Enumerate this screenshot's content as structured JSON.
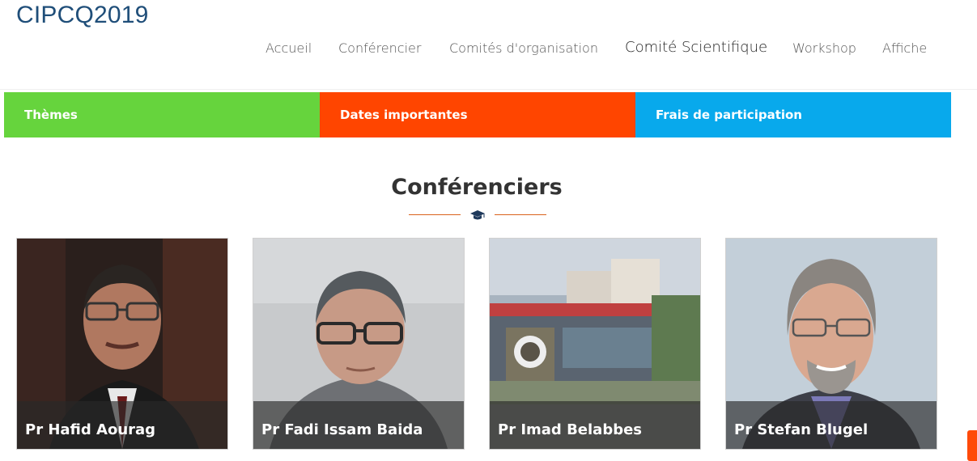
{
  "brand": {
    "title": "CIPCQ2019"
  },
  "nav": {
    "items": [
      {
        "label": "Accueil"
      },
      {
        "label": "Conférencier"
      },
      {
        "label": "Comités d'organisation"
      },
      {
        "label": "Comité Scientifique"
      },
      {
        "label": "Workshop"
      },
      {
        "label": "Affiche"
      }
    ]
  },
  "tabs": [
    {
      "label": "Thèmes",
      "color": "#66d43d"
    },
    {
      "label": "Dates importantes",
      "color": "#ff4500"
    },
    {
      "label": "Frais de participation",
      "color": "#08a9ec"
    }
  ],
  "section": {
    "title": "Conférenciers",
    "icon": "graduation-cap-icon"
  },
  "speakers": [
    {
      "name": "Pr Hafid Aourag"
    },
    {
      "name": "Pr Fadi Issam Baida"
    },
    {
      "name": "Pr Imad Belabbes"
    },
    {
      "name": "Pr Stefan Blugel"
    }
  ],
  "colors": {
    "brand": "#1f4e79",
    "accent": "#d9621d"
  }
}
